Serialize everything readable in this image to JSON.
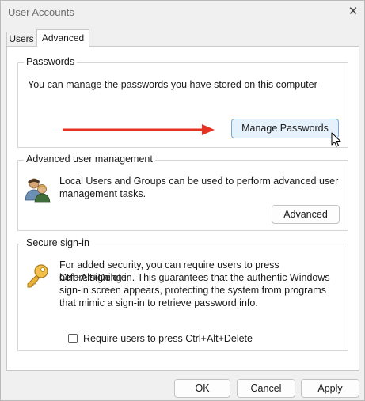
{
  "window": {
    "title": "User Accounts",
    "close_glyph": "✕"
  },
  "tabs": [
    {
      "label": "Users"
    },
    {
      "label": "Advanced"
    }
  ],
  "passwords": {
    "heading": "Passwords",
    "description": "You can manage the passwords you have stored on this computer",
    "button_label": "Manage Passwords"
  },
  "advanced_management": {
    "heading": "Advanced user management",
    "description_line1": "Local Users and Groups can be used to perform advanced user",
    "description_line2": "management tasks.",
    "button_label": "Advanced"
  },
  "secure_signin": {
    "heading": "Secure sign-in",
    "description_lines": [
      "For added security, you can require users to press Ctrl+Alt+Delete",
      "before signing in. This guarantees that the authentic Windows",
      "sign-in screen appears, protecting the system from programs",
      "that mimic a sign-in to retrieve password info."
    ],
    "checkbox_label": "Require users to press Ctrl+Alt+Delete",
    "checkbox_checked": false
  },
  "footer": {
    "ok_label": "OK",
    "cancel_label": "Cancel",
    "apply_label": "Apply"
  },
  "colors": {
    "annotation_arrow": "#e53222",
    "manage_button_highlight": "#e5f1fb"
  }
}
